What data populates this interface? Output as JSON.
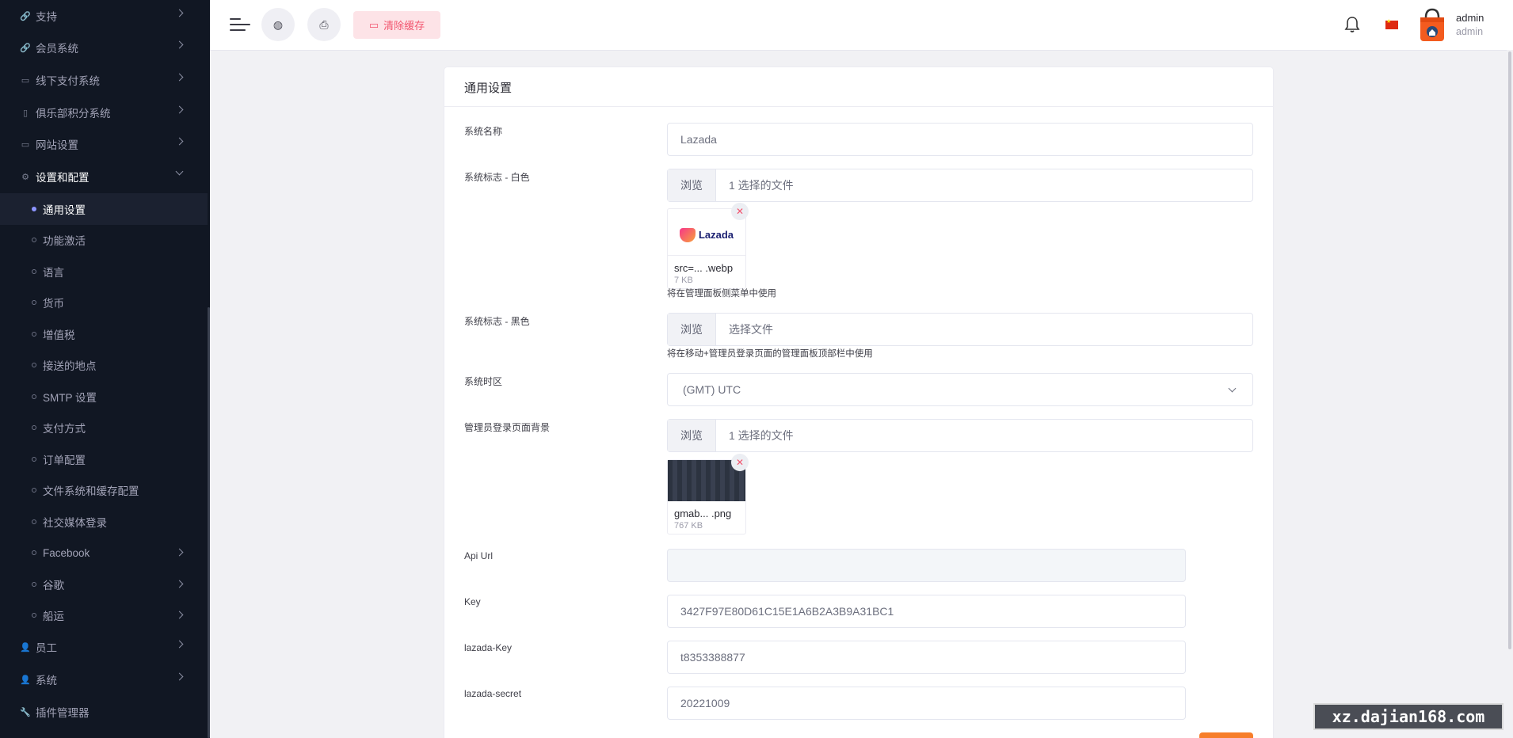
{
  "sidebar": {
    "items": [
      {
        "label": "支持",
        "icon": "link-icon"
      },
      {
        "label": "会员系统",
        "icon": "link-icon"
      },
      {
        "label": "线下支付系统",
        "icon": "money-icon"
      },
      {
        "label": "俱乐部积分系统",
        "icon": "battery-icon"
      },
      {
        "label": "网站设置",
        "icon": "desktop-icon"
      },
      {
        "label": "设置和配置",
        "icon": "gear-icon"
      }
    ],
    "sub_items": [
      {
        "label": "通用设置"
      },
      {
        "label": "功能激活"
      },
      {
        "label": "语言"
      },
      {
        "label": "货币"
      },
      {
        "label": "增值税"
      },
      {
        "label": "接送的地点"
      },
      {
        "label": "SMTP 设置"
      },
      {
        "label": "支付方式"
      },
      {
        "label": "订单配置"
      },
      {
        "label": "文件系统和缓存配置"
      },
      {
        "label": "社交媒体登录"
      },
      {
        "label": "Facebook"
      },
      {
        "label": "谷歌"
      },
      {
        "label": "船运"
      }
    ],
    "bottom_items": [
      {
        "label": "员工",
        "icon": "user-icon"
      },
      {
        "label": "系统",
        "icon": "user-icon"
      },
      {
        "label": "插件管理器",
        "icon": "wrench-icon"
      }
    ]
  },
  "header": {
    "clear_cache_label": "清除缓存",
    "user_name": "admin",
    "user_role": "admin"
  },
  "card": {
    "title": "通用设置",
    "system_name": {
      "label": "系统名称",
      "value": "Lazada"
    },
    "logo_white": {
      "label": "系统标志 - 白色",
      "browse": "浏览",
      "file_text": "1 选择的文件",
      "thumb_name": "src=... .webp",
      "thumb_size": "7 KB",
      "thumb_logo_text": "Lazada",
      "hint": "将在管理面板侧菜单中使用"
    },
    "logo_black": {
      "label": "系统标志 - 黑色",
      "browse": "浏览",
      "file_text": "选择文件",
      "hint": "将在移动+管理员登录页面的管理面板顶部栏中使用"
    },
    "timezone": {
      "label": "系统时区",
      "value": "(GMT) UTC"
    },
    "login_bg": {
      "label": "管理员登录页面背景",
      "browse": "浏览",
      "file_text": "1 选择的文件",
      "thumb_name": "gmab... .png",
      "thumb_size": "767 KB"
    },
    "api_url": {
      "label": "Api Url",
      "value": ""
    },
    "key": {
      "label": "Key",
      "value": "3427F97E80D61C15E1A6B2A3B9A31BC1"
    },
    "lazada_key": {
      "label": "lazada-Key",
      "value": "t8353388877"
    },
    "lazada_secret": {
      "label": "lazada-secret",
      "value": "20221009"
    }
  },
  "watermark": "xz.dajian168.com",
  "colors": {
    "sidebar_bg": "#111723",
    "accent": "#f2546e",
    "save_button": "#f77e2a"
  }
}
